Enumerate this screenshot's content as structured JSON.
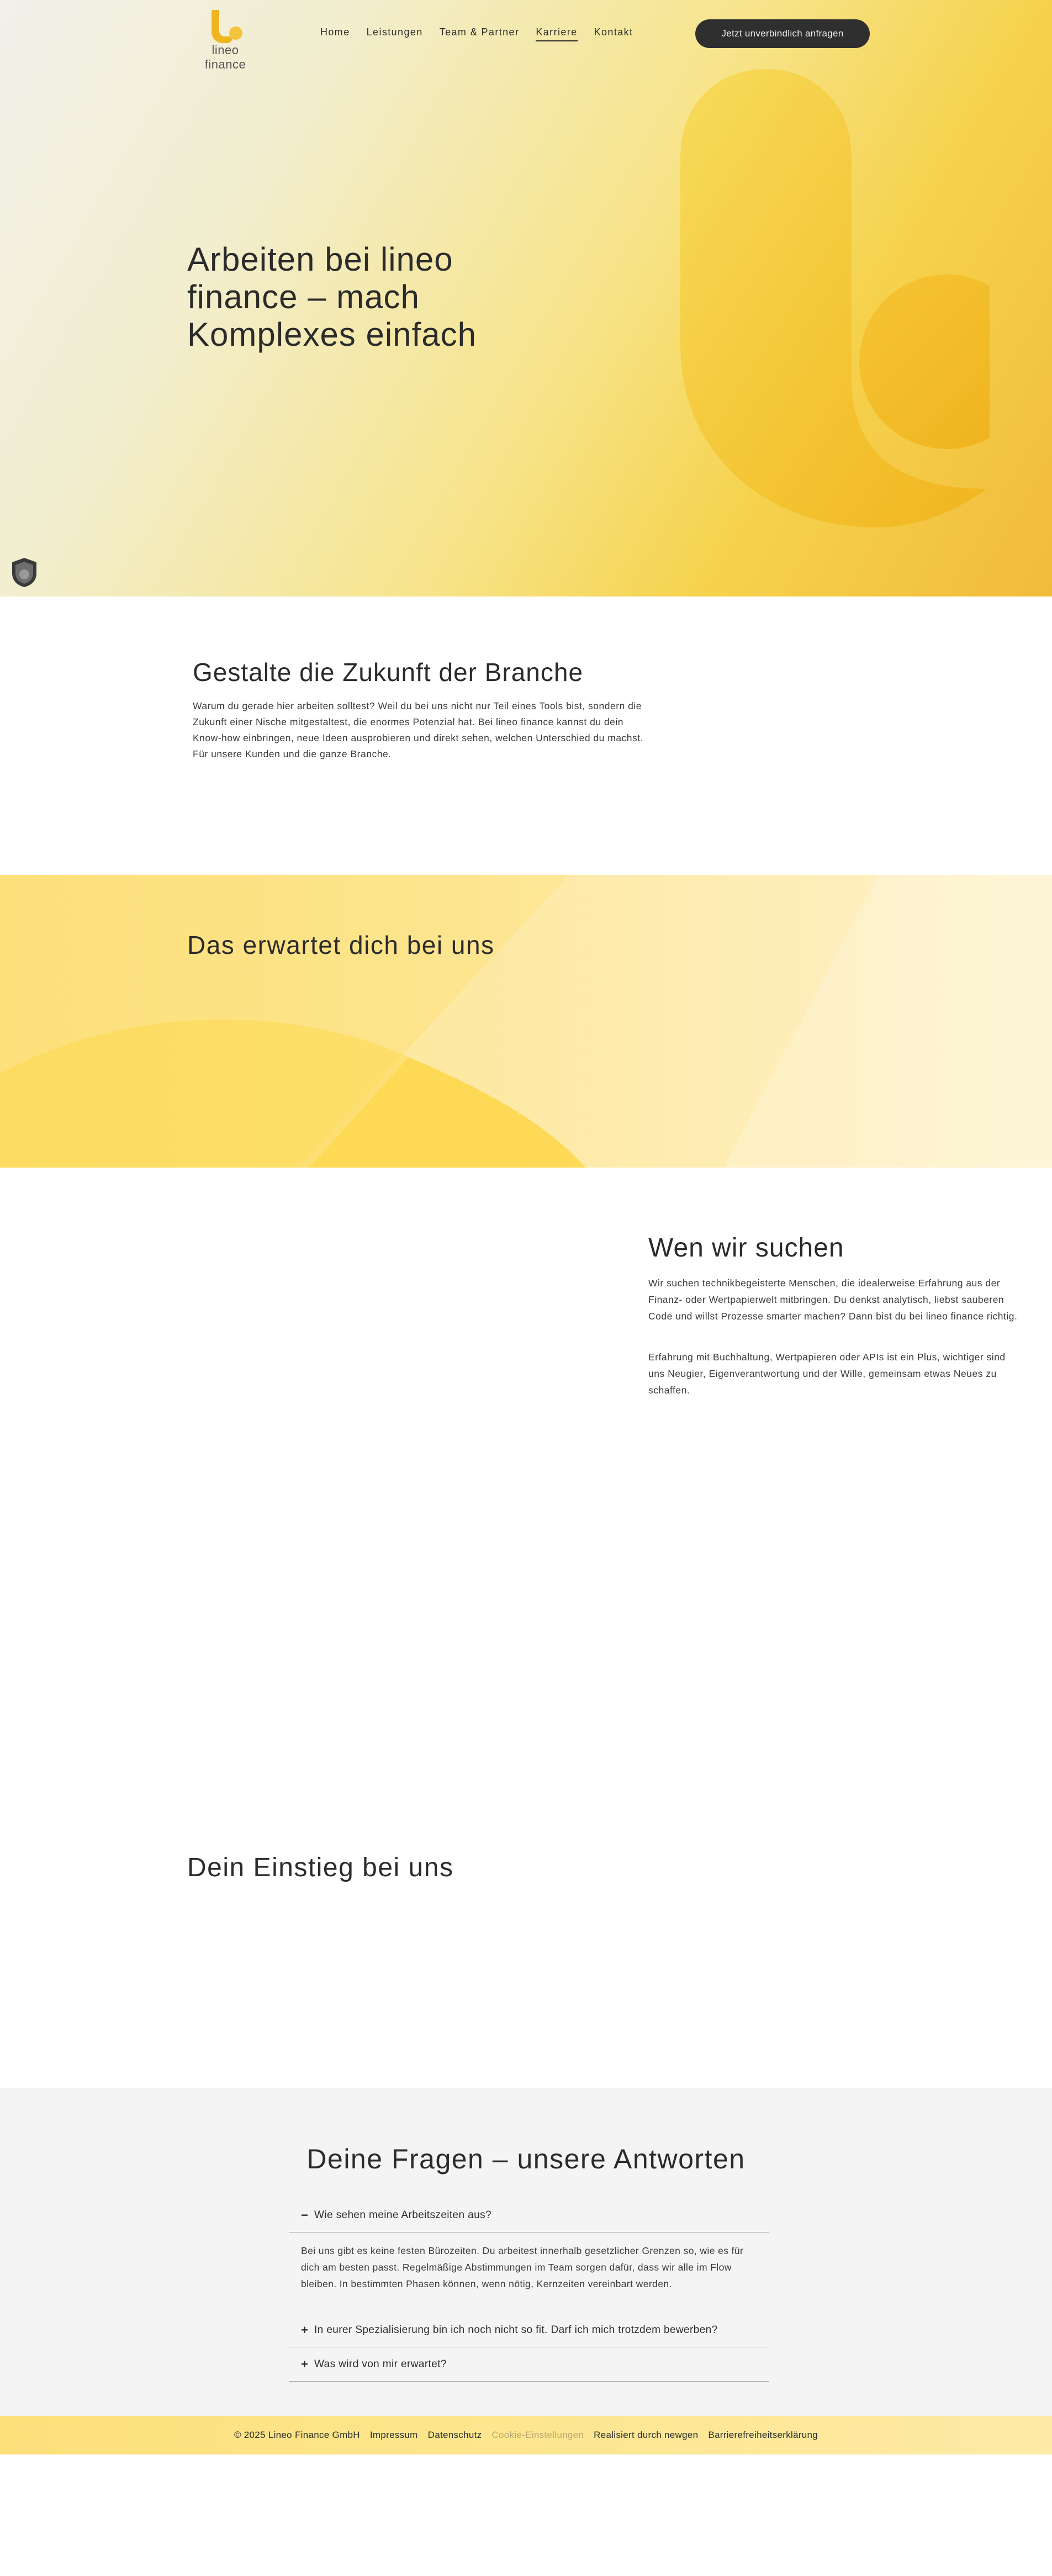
{
  "header": {
    "logo_text": "lineo finance",
    "nav": [
      {
        "label": "Home",
        "active": false
      },
      {
        "label": "Leistungen",
        "active": false
      },
      {
        "label": "Team & Partner",
        "active": false
      },
      {
        "label": "Karriere",
        "active": true
      },
      {
        "label": "Kontakt",
        "active": false
      }
    ],
    "cta_label": "Jetzt unverbindlich anfragen"
  },
  "hero": {
    "title": "Arbeiten bei lineo finance – mach Komplexes einfach"
  },
  "gestalte": {
    "title": "Gestalte die Zukunft der Branche",
    "text": "Warum du gerade hier arbeiten solltest? Weil du bei uns nicht nur Teil eines Tools bist, sondern die Zukunft einer Nische mitgestaltest, die enormes Potenzial hat. Bei lineo finance kannst du dein Know-how einbringen, neue Ideen ausprobieren und direkt sehen, welchen Unterschied du machst. Für unsere Kunden und die ganze Branche."
  },
  "erwartet": {
    "title": "Das erwartet dich bei uns"
  },
  "wen": {
    "title": "Wen wir suchen",
    "p1": "Wir suchen technikbegeisterte Menschen, die idealerweise Erfahrung aus der Finanz- oder Wertpapierwelt mitbringen. Du denkst analytisch, liebst sauberen Code und willst Prozesse smarter machen? Dann bist du bei lineo finance richtig.",
    "p2": "Erfahrung mit Buchhaltung, Wertpapieren oder APIs ist ein Plus, wichtiger sind uns Neugier, Eigenverantwortung und der Wille, gemeinsam etwas Neues zu schaffen."
  },
  "einstieg": {
    "title": "Dein Einstieg bei uns"
  },
  "faq": {
    "title": "Deine Fragen – unsere Antworten",
    "items": [
      {
        "question": "Wie sehen meine Arbeitszeiten aus?",
        "open": true,
        "symbol": "−",
        "answer": "Bei uns gibt es keine festen Bürozeiten. Du arbeitest innerhalb gesetzlicher Grenzen so, wie es für dich am besten passt. Regelmäßige Abstimmungen im Team sorgen dafür, dass wir alle im Flow bleiben. In bestimmten Phasen können, wenn nötig, Kernzeiten vereinbart werden."
      },
      {
        "question": "In eurer Spezialisierung bin ich noch nicht so fit. Darf ich mich trotzdem bewerben?",
        "open": false,
        "symbol": "+"
      },
      {
        "question": "Was wird von mir erwartet?",
        "open": false,
        "symbol": "+"
      }
    ]
  },
  "footer": {
    "copyright": "© 2025 Lineo Finance GmbH",
    "links": [
      "Impressum",
      "Datenschutz",
      "Cookie-Einstellungen",
      "Realisiert durch newgen",
      "Barrierefreiheitserklärung"
    ]
  },
  "colors": {
    "brand_yellow": "#f3be1f",
    "dark": "#2f2f2f",
    "faq_bg": "#f4f4f4"
  }
}
